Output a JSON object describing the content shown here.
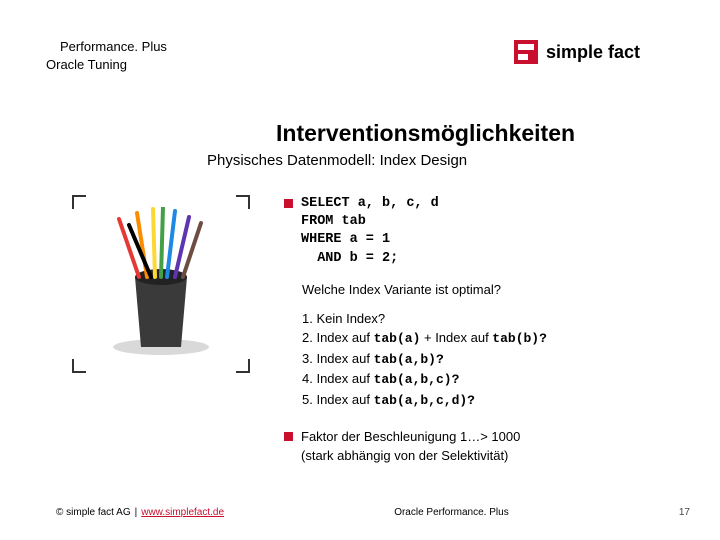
{
  "header": {
    "line1": "Performance. Plus",
    "line2": "Oracle Tuning"
  },
  "logo": {
    "text": "simple fact",
    "mark_name": "logo-mark"
  },
  "title": "Interventionsmöglichkeiten",
  "subtitle": "Physisches Datenmodell: Index Design",
  "image_alt": "Stiftebecher mit Buntstiften",
  "sql": {
    "l1": "SELECT a, b, c, d",
    "l2": "FROM tab",
    "l3": "WHERE a = 1",
    "l4": "  AND b = 2;"
  },
  "question": "Welche Index Variante ist optimal?",
  "options": {
    "o1_pre": "1. Kein Index?",
    "o2_pre": "2. Index auf ",
    "o2_code": "tab(a)",
    "o2_mid": " + Index auf ",
    "o2_code2": "tab(b)?",
    "o3_pre": "3. Index auf ",
    "o3_code": "tab(a,b)?",
    "o4_pre": "4. Index auf ",
    "o4_code": "tab(a,b,c)?",
    "o5_pre": "5. Index auf ",
    "o5_code": "tab(a,b,c,d)?"
  },
  "factor": {
    "l1": "Faktor der Beschleunigung 1…> 1000",
    "l2": "(stark abhängig von der Selektivität)"
  },
  "footer": {
    "copyright": "© simple fact AG",
    "separator": "|",
    "link_text": "www.simplefact.de",
    "link_href": "http://www.simplefact.de",
    "center": "Oracle Performance. Plus",
    "page": "17"
  },
  "colors": {
    "accent": "#c8102e"
  }
}
